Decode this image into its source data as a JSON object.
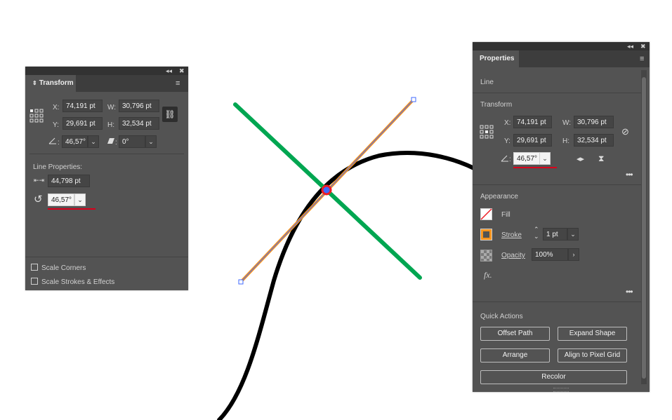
{
  "transform_panel": {
    "tab_label": "Transform",
    "x_label": "X:",
    "x_value": "74,191 pt",
    "y_label": "Y:",
    "y_value": "29,691 pt",
    "w_label": "W:",
    "w_value": "30,796 pt",
    "h_label": "H:",
    "h_value": "32,534 pt",
    "angle_label": ":",
    "angle_value": "46,57°",
    "shear_label": ":",
    "shear_value": "0°",
    "line_properties_label": "Line Properties:",
    "length_value": "44,798 pt",
    "line_angle_value": "46,57°",
    "scale_corners_label": "Scale Corners",
    "scale_strokes_label": "Scale Strokes & Effects"
  },
  "properties_panel": {
    "tab_label": "Properties",
    "section_line": "Line",
    "section_transform": "Transform",
    "x_label": "X:",
    "x_value": "74,191 pt",
    "y_label": "Y:",
    "y_value": "29,691 pt",
    "w_label": "W:",
    "w_value": "30,796 pt",
    "h_label": "H:",
    "h_value": "32,534 pt",
    "angle_label": ":",
    "angle_value": "46,57°",
    "section_appearance": "Appearance",
    "fill_label": "Fill",
    "stroke_label": "Stroke",
    "stroke_value": "1 pt",
    "opacity_label": "Opacity",
    "opacity_value": "100%",
    "fx_label": "fx.",
    "section_quick_actions": "Quick Actions",
    "offset_path": "Offset Path",
    "expand_shape": "Expand Shape",
    "arrange": "Arrange",
    "align_pixel_grid": "Align to Pixel Grid",
    "recolor": "Recolor"
  },
  "colors": {
    "green_line": "#00a651",
    "orange_line": "#f7941d",
    "anchor_red": "#ed1c24",
    "selection_blue": "#3f68ff",
    "annotation_red": "#d9001b"
  }
}
